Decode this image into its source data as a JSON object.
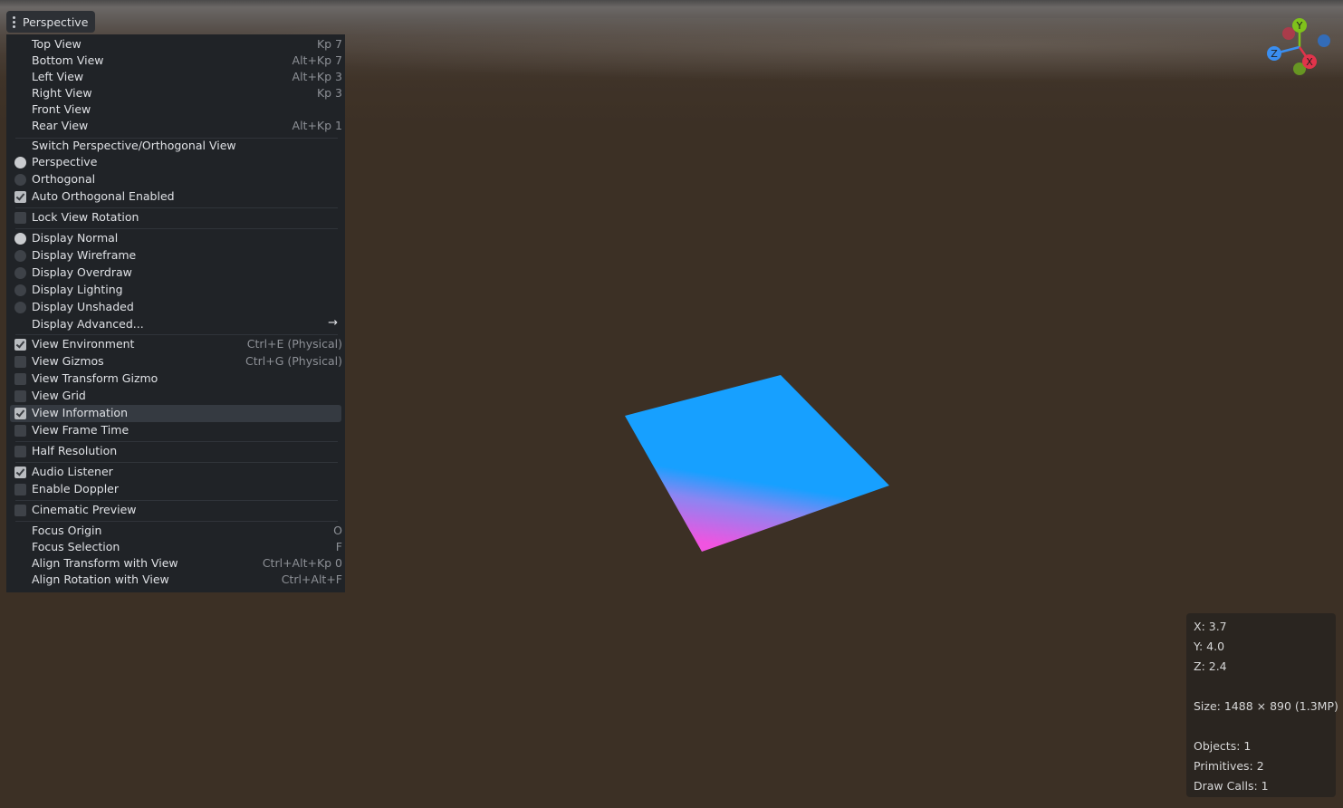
{
  "toolbar": {
    "perspective_label": "Perspective"
  },
  "menu": {
    "items": [
      {
        "label": "Top View",
        "shortcut": "Kp 7"
      },
      {
        "label": "Bottom View",
        "shortcut": "Alt+Kp 7"
      },
      {
        "label": "Left View",
        "shortcut": "Alt+Kp 3"
      },
      {
        "label": "Right View",
        "shortcut": "Kp 3"
      },
      {
        "label": "Front View",
        "shortcut": ""
      },
      {
        "label": "Rear View",
        "shortcut": "Alt+Kp 1"
      },
      {
        "label": "Switch Perspective/Orthogonal View",
        "shortcut": ""
      },
      {
        "label": "Perspective",
        "shortcut": "",
        "indicator": "radio",
        "checked": true
      },
      {
        "label": "Orthogonal",
        "shortcut": "",
        "indicator": "radio",
        "checked": false
      },
      {
        "label": "Auto Orthogonal Enabled",
        "shortcut": "",
        "indicator": "check",
        "checked": true
      },
      {
        "label": "Lock View Rotation",
        "shortcut": "",
        "indicator": "check",
        "checked": false
      },
      {
        "label": "Display Normal",
        "shortcut": "",
        "indicator": "radio",
        "checked": true
      },
      {
        "label": "Display Wireframe",
        "shortcut": "",
        "indicator": "radio",
        "checked": false
      },
      {
        "label": "Display Overdraw",
        "shortcut": "",
        "indicator": "radio",
        "checked": false
      },
      {
        "label": "Display Lighting",
        "shortcut": "",
        "indicator": "radio",
        "checked": false
      },
      {
        "label": "Display Unshaded",
        "shortcut": "",
        "indicator": "radio",
        "checked": false
      },
      {
        "label": "Display Advanced...",
        "shortcut": ""
      },
      {
        "label": "View Environment",
        "shortcut": "Ctrl+E (Physical)",
        "indicator": "check",
        "checked": true
      },
      {
        "label": "View Gizmos",
        "shortcut": "Ctrl+G (Physical)",
        "indicator": "check",
        "checked": false
      },
      {
        "label": "View Transform Gizmo",
        "shortcut": "",
        "indicator": "check",
        "checked": false
      },
      {
        "label": "View Grid",
        "shortcut": "",
        "indicator": "check",
        "checked": false
      },
      {
        "label": "View Information",
        "shortcut": "",
        "indicator": "check",
        "checked": true
      },
      {
        "label": "View Frame Time",
        "shortcut": "",
        "indicator": "check",
        "checked": false
      },
      {
        "label": "Half Resolution",
        "shortcut": "",
        "indicator": "check",
        "checked": false
      },
      {
        "label": "Audio Listener",
        "shortcut": "",
        "indicator": "check",
        "checked": true
      },
      {
        "label": "Enable Doppler",
        "shortcut": "",
        "indicator": "check",
        "checked": false
      },
      {
        "label": "Cinematic Preview",
        "shortcut": "",
        "indicator": "check",
        "checked": false
      },
      {
        "label": "Focus Origin",
        "shortcut": "O"
      },
      {
        "label": "Focus Selection",
        "shortcut": "F"
      },
      {
        "label": "Align Transform with View",
        "shortcut": "Ctrl+Alt+Kp 0"
      },
      {
        "label": "Align Rotation with View",
        "shortcut": "Ctrl+Alt+F"
      }
    ]
  },
  "gizmo": {
    "y_label": "Y",
    "z_label": "Z",
    "x_label": "X"
  },
  "info": {
    "x": "X: 3.7",
    "y": "Y: 4.0",
    "z": "Z: 2.4",
    "size": "Size: 1488 × 890 (1.3MP)",
    "objects": "Objects: 1",
    "primitives": "Primitives: 2",
    "draw_calls": "Draw Calls: 1"
  },
  "colors": {
    "axis_x": "#e0344b",
    "axis_y": "#7fc21b",
    "axis_z": "#3a8ef0",
    "plane_top": "#17a0ff",
    "plane_bottom": "#f054e0"
  }
}
